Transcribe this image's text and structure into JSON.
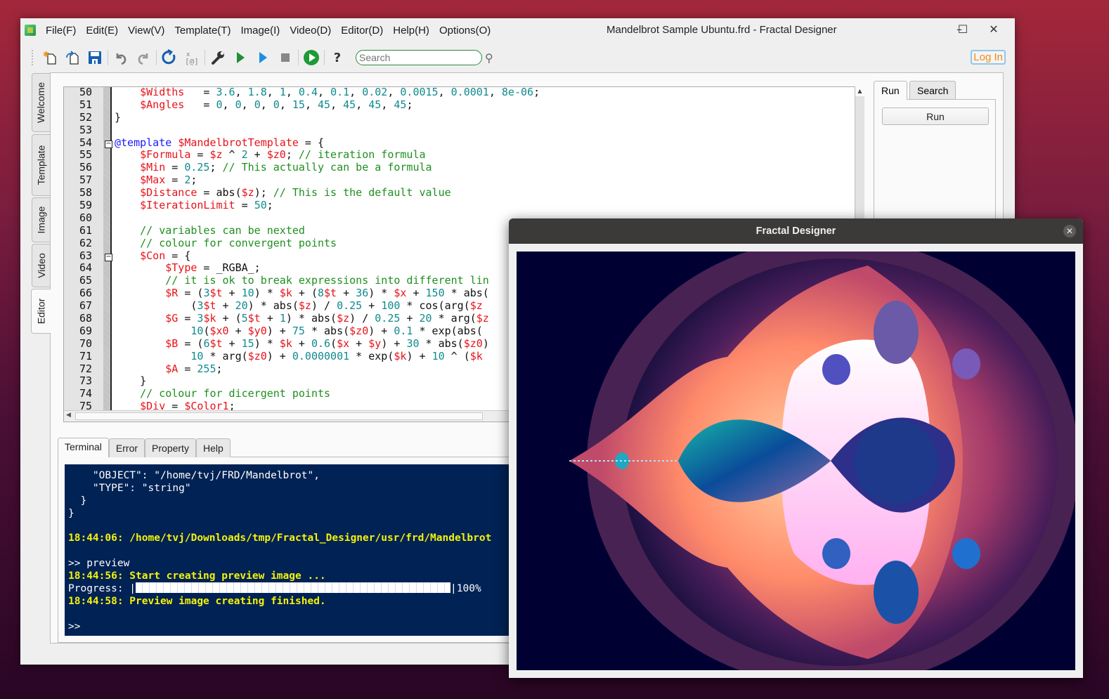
{
  "window": {
    "title": "Mandelbrot Sample Ubuntu.frd - Fractal Designer",
    "controls": {
      "minimize": "–",
      "maximize": "☐",
      "close": "✕"
    }
  },
  "menu": [
    "File(F)",
    "Edit(E)",
    "View(V)",
    "Template(T)",
    "Image(I)",
    "Video(D)",
    "Editor(D)",
    "Help(H)",
    "Options(O)"
  ],
  "toolbar": {
    "buttons": [
      {
        "name": "new-file-icon",
        "glyph": "✱"
      },
      {
        "name": "open-file-icon",
        "glyph": "⎘"
      },
      {
        "name": "save-icon",
        "glyph": "💾"
      },
      {
        "name": "undo-icon",
        "glyph": "↶"
      },
      {
        "name": "redo-icon",
        "glyph": "↷"
      },
      {
        "name": "refresh-icon",
        "glyph": "↻"
      },
      {
        "name": "clear-icon",
        "glyph": "⌧"
      },
      {
        "name": "settings-wrench-icon",
        "glyph": "🔧"
      },
      {
        "name": "run-icon",
        "glyph": "▶"
      },
      {
        "name": "run-preview-icon",
        "glyph": "▶"
      },
      {
        "name": "stop-icon",
        "glyph": "■"
      },
      {
        "name": "play-circle-icon",
        "glyph": "▶"
      },
      {
        "name": "help-icon",
        "glyph": "?"
      }
    ],
    "search_placeholder": "Search",
    "login_label": "Log In"
  },
  "side_tabs": [
    "Welcome",
    "Template",
    "Image",
    "Video",
    "Editor"
  ],
  "active_side_tab": "Editor",
  "editor": {
    "lines": [
      {
        "no": "50",
        "tokens": [
          [
            "t",
            "    "
          ],
          [
            "v",
            "$Widths"
          ],
          [
            "t",
            "   = "
          ],
          [
            "n",
            "3.6"
          ],
          [
            "t",
            ", "
          ],
          [
            "n",
            "1.8"
          ],
          [
            "t",
            ", "
          ],
          [
            "n",
            "1"
          ],
          [
            "t",
            ", "
          ],
          [
            "n",
            "0.4"
          ],
          [
            "t",
            ", "
          ],
          [
            "n",
            "0.1"
          ],
          [
            "t",
            ", "
          ],
          [
            "n",
            "0.02"
          ],
          [
            "t",
            ", "
          ],
          [
            "n",
            "0.0015"
          ],
          [
            "t",
            ", "
          ],
          [
            "n",
            "0.0001"
          ],
          [
            "t",
            ", "
          ],
          [
            "n",
            "8e-06"
          ],
          [
            "t",
            ";"
          ]
        ]
      },
      {
        "no": "51",
        "tokens": [
          [
            "t",
            "    "
          ],
          [
            "v",
            "$Angles"
          ],
          [
            "t",
            "   = "
          ],
          [
            "n",
            "0"
          ],
          [
            "t",
            ", "
          ],
          [
            "n",
            "0"
          ],
          [
            "t",
            ", "
          ],
          [
            "n",
            "0"
          ],
          [
            "t",
            ", "
          ],
          [
            "n",
            "0"
          ],
          [
            "t",
            ", "
          ],
          [
            "n",
            "15"
          ],
          [
            "t",
            ", "
          ],
          [
            "n",
            "45"
          ],
          [
            "t",
            ", "
          ],
          [
            "n",
            "45"
          ],
          [
            "t",
            ", "
          ],
          [
            "n",
            "45"
          ],
          [
            "t",
            ", "
          ],
          [
            "n",
            "45"
          ],
          [
            "t",
            ";"
          ]
        ]
      },
      {
        "no": "52",
        "tokens": [
          [
            "t",
            "}"
          ]
        ]
      },
      {
        "no": "53",
        "tokens": []
      },
      {
        "no": "54",
        "tokens": [
          [
            "k",
            "@template"
          ],
          [
            "t",
            " "
          ],
          [
            "v",
            "$MandelbrotTemplate"
          ],
          [
            "t",
            " = {"
          ]
        ]
      },
      {
        "no": "55",
        "tokens": [
          [
            "t",
            "    "
          ],
          [
            "v",
            "$Formula"
          ],
          [
            "t",
            " = "
          ],
          [
            "v",
            "$z"
          ],
          [
            "t",
            " ^ "
          ],
          [
            "n",
            "2"
          ],
          [
            "t",
            " + "
          ],
          [
            "v",
            "$z0"
          ],
          [
            "t",
            "; "
          ],
          [
            "c",
            "// iteration formula"
          ]
        ]
      },
      {
        "no": "56",
        "tokens": [
          [
            "t",
            "    "
          ],
          [
            "v",
            "$Min"
          ],
          [
            "t",
            " = "
          ],
          [
            "n",
            "0.25"
          ],
          [
            "t",
            "; "
          ],
          [
            "c",
            "// This actually can be a formula"
          ]
        ]
      },
      {
        "no": "57",
        "tokens": [
          [
            "t",
            "    "
          ],
          [
            "v",
            "$Max"
          ],
          [
            "t",
            " = "
          ],
          [
            "n",
            "2"
          ],
          [
            "t",
            ";"
          ]
        ]
      },
      {
        "no": "58",
        "tokens": [
          [
            "t",
            "    "
          ],
          [
            "v",
            "$Distance"
          ],
          [
            "t",
            " = abs("
          ],
          [
            "v",
            "$z"
          ],
          [
            "t",
            "); "
          ],
          [
            "c",
            "// This is the default value"
          ]
        ]
      },
      {
        "no": "59",
        "tokens": [
          [
            "t",
            "    "
          ],
          [
            "v",
            "$IterationLimit"
          ],
          [
            "t",
            " = "
          ],
          [
            "n",
            "50"
          ],
          [
            "t",
            ";"
          ]
        ]
      },
      {
        "no": "60",
        "tokens": []
      },
      {
        "no": "61",
        "tokens": [
          [
            "t",
            "    "
          ],
          [
            "c",
            "// variables can be nexted"
          ]
        ]
      },
      {
        "no": "62",
        "tokens": [
          [
            "t",
            "    "
          ],
          [
            "c",
            "// colour for convergent points"
          ]
        ]
      },
      {
        "no": "63",
        "tokens": [
          [
            "t",
            "    "
          ],
          [
            "v",
            "$Con"
          ],
          [
            "t",
            " = {"
          ]
        ]
      },
      {
        "no": "64",
        "tokens": [
          [
            "t",
            "        "
          ],
          [
            "v",
            "$Type"
          ],
          [
            "t",
            " = _RGBA_;"
          ]
        ]
      },
      {
        "no": "65",
        "tokens": [
          [
            "t",
            "        "
          ],
          [
            "c",
            "// it is ok to break expressions into different lin"
          ]
        ]
      },
      {
        "no": "66",
        "tokens": [
          [
            "t",
            "        "
          ],
          [
            "v",
            "$R"
          ],
          [
            "t",
            " = ("
          ],
          [
            "n",
            "3"
          ],
          [
            "v",
            "$t"
          ],
          [
            "t",
            " + "
          ],
          [
            "n",
            "10"
          ],
          [
            "t",
            ") * "
          ],
          [
            "v",
            "$k"
          ],
          [
            "t",
            " + ("
          ],
          [
            "n",
            "8"
          ],
          [
            "v",
            "$t"
          ],
          [
            "t",
            " + "
          ],
          [
            "n",
            "36"
          ],
          [
            "t",
            ") * "
          ],
          [
            "v",
            "$x"
          ],
          [
            "t",
            " + "
          ],
          [
            "n",
            "150"
          ],
          [
            "t",
            " * abs("
          ]
        ]
      },
      {
        "no": "67",
        "tokens": [
          [
            "t",
            "            ("
          ],
          [
            "n",
            "3"
          ],
          [
            "v",
            "$t"
          ],
          [
            "t",
            " + "
          ],
          [
            "n",
            "20"
          ],
          [
            "t",
            ") * abs("
          ],
          [
            "v",
            "$z"
          ],
          [
            "t",
            ") / "
          ],
          [
            "n",
            "0.25"
          ],
          [
            "t",
            " + "
          ],
          [
            "n",
            "100"
          ],
          [
            "t",
            " * cos(arg("
          ],
          [
            "v",
            "$z"
          ]
        ]
      },
      {
        "no": "68",
        "tokens": [
          [
            "t",
            "        "
          ],
          [
            "v",
            "$G"
          ],
          [
            "t",
            " = "
          ],
          [
            "n",
            "3"
          ],
          [
            "v",
            "$k"
          ],
          [
            "t",
            " + ("
          ],
          [
            "n",
            "5"
          ],
          [
            "v",
            "$t"
          ],
          [
            "t",
            " + "
          ],
          [
            "n",
            "1"
          ],
          [
            "t",
            ") * abs("
          ],
          [
            "v",
            "$z"
          ],
          [
            "t",
            ") / "
          ],
          [
            "n",
            "0.25"
          ],
          [
            "t",
            " + "
          ],
          [
            "n",
            "20"
          ],
          [
            "t",
            " * arg("
          ],
          [
            "v",
            "$z"
          ]
        ]
      },
      {
        "no": "69",
        "tokens": [
          [
            "t",
            "            "
          ],
          [
            "n",
            "10"
          ],
          [
            "t",
            "("
          ],
          [
            "v",
            "$x0"
          ],
          [
            "t",
            " + "
          ],
          [
            "v",
            "$y0"
          ],
          [
            "t",
            ") + "
          ],
          [
            "n",
            "75"
          ],
          [
            "t",
            " * abs("
          ],
          [
            "v",
            "$z0"
          ],
          [
            "t",
            ") + "
          ],
          [
            "n",
            "0.1"
          ],
          [
            "t",
            " * exp(abs("
          ]
        ]
      },
      {
        "no": "70",
        "tokens": [
          [
            "t",
            "        "
          ],
          [
            "v",
            "$B"
          ],
          [
            "t",
            " = ("
          ],
          [
            "n",
            "6"
          ],
          [
            "v",
            "$t"
          ],
          [
            "t",
            " + "
          ],
          [
            "n",
            "15"
          ],
          [
            "t",
            ") * "
          ],
          [
            "v",
            "$k"
          ],
          [
            "t",
            " + "
          ],
          [
            "n",
            "0.6"
          ],
          [
            "t",
            "("
          ],
          [
            "v",
            "$x"
          ],
          [
            "t",
            " + "
          ],
          [
            "v",
            "$y"
          ],
          [
            "t",
            ") + "
          ],
          [
            "n",
            "30"
          ],
          [
            "t",
            " * abs("
          ],
          [
            "v",
            "$z0"
          ],
          [
            "t",
            ")"
          ]
        ]
      },
      {
        "no": "71",
        "tokens": [
          [
            "t",
            "            "
          ],
          [
            "n",
            "10"
          ],
          [
            "t",
            " * arg("
          ],
          [
            "v",
            "$z0"
          ],
          [
            "t",
            ") + "
          ],
          [
            "n",
            "0.0000001"
          ],
          [
            "t",
            " * exp("
          ],
          [
            "v",
            "$k"
          ],
          [
            "t",
            ") + "
          ],
          [
            "n",
            "10"
          ],
          [
            "t",
            " ^ ("
          ],
          [
            "v",
            "$k"
          ]
        ]
      },
      {
        "no": "72",
        "tokens": [
          [
            "t",
            "        "
          ],
          [
            "v",
            "$A"
          ],
          [
            "t",
            " = "
          ],
          [
            "n",
            "255"
          ],
          [
            "t",
            ";"
          ]
        ]
      },
      {
        "no": "73",
        "tokens": [
          [
            "t",
            "    }"
          ]
        ]
      },
      {
        "no": "74",
        "tokens": [
          [
            "t",
            "    "
          ],
          [
            "c",
            "// colour for dicergent points"
          ]
        ]
      },
      {
        "no": "75",
        "tokens": [
          [
            "t",
            "    "
          ],
          [
            "v",
            "$Div"
          ],
          [
            "t",
            " = "
          ],
          [
            "v",
            "$Color1"
          ],
          [
            "t",
            ";"
          ]
        ]
      }
    ]
  },
  "right_panel": {
    "tabs": [
      "Run",
      "Search"
    ],
    "active_tab": "Run",
    "run_button": "Run"
  },
  "bottom_tabs": [
    "Terminal",
    "Error",
    "Property",
    "Help"
  ],
  "active_bottom_tab": "Terminal",
  "terminal": {
    "lines": [
      {
        "style": "normal",
        "text": "    \"OBJECT\": \"/home/tvj/FRD/Mandelbrot\","
      },
      {
        "style": "normal",
        "text": "    \"TYPE\": \"string\""
      },
      {
        "style": "normal",
        "text": "  }"
      },
      {
        "style": "normal",
        "text": "}"
      },
      {
        "style": "normal",
        "text": ""
      },
      {
        "style": "highlight",
        "text": "18:44:06: /home/tvj/Downloads/tmp/Fractal_Designer/usr/frd/Mandelbrot"
      },
      {
        "style": "normal",
        "text": ""
      },
      {
        "style": "normal",
        "text": ">> preview"
      },
      {
        "style": "highlight",
        "text": "18:44:56: Start creating preview image ..."
      },
      {
        "style": "progress",
        "text": "Progress: |"
      },
      {
        "style": "highlight",
        "text": "18:44:58: Preview image creating finished."
      },
      {
        "style": "normal",
        "text": ""
      },
      {
        "style": "normal",
        "text": ">>"
      }
    ],
    "progress_percent": 100,
    "progress_label": "|100%"
  },
  "preview_window": {
    "title": "Fractal Designer",
    "close": "✕",
    "image_alt": "Mandelbrot fractal preview"
  },
  "colors": {
    "terminal_bg": "#002254",
    "terminal_highlight": "#f4f20a",
    "variable": "#e8121a",
    "number": "#108a8e",
    "comment": "#1f8f1f",
    "keyword": "#1a1aff",
    "login": "#f08a14"
  }
}
